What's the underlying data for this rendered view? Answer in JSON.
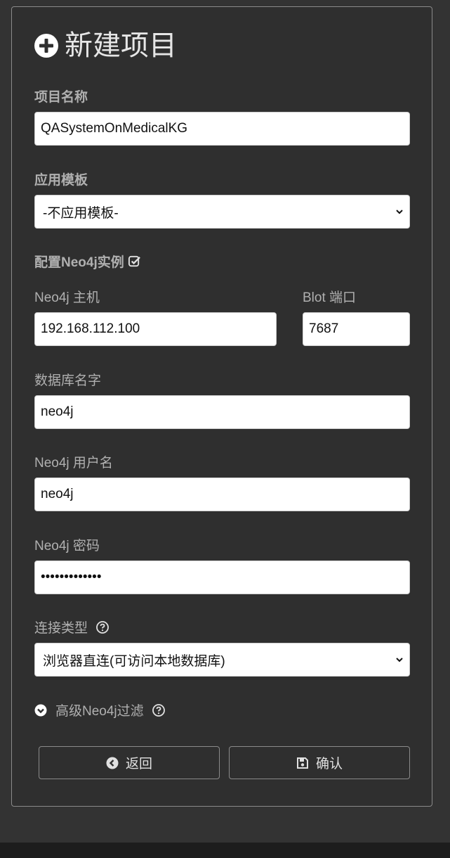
{
  "header": {
    "title": "新建项目",
    "icon": "plus-circle-icon"
  },
  "form": {
    "project_name": {
      "label": "项目名称",
      "value": "QASystemOnMedicalKG"
    },
    "template": {
      "label": "应用模板",
      "selected": "-不应用模板-"
    },
    "neo4j_config": {
      "label": "配置Neo4j实例",
      "icon": "checkbox-checked-icon"
    },
    "host": {
      "label": "Neo4j 主机",
      "value": "192.168.112.100"
    },
    "port": {
      "label": "Blot 端口",
      "value": "7687"
    },
    "database": {
      "label": "数据库名字",
      "value": "neo4j"
    },
    "username": {
      "label": "Neo4j 用户名",
      "value": "neo4j"
    },
    "password": {
      "label": "Neo4j 密码",
      "value": "•••••••••••••"
    },
    "connection_type": {
      "label": "连接类型",
      "selected": "浏览器直连(可访问本地数据库)",
      "help_icon": "question-circle-icon"
    },
    "advanced_filter": {
      "label": "高级Neo4j过滤",
      "icon": "chevron-circle-down-icon",
      "help_icon": "question-circle-icon"
    }
  },
  "actions": {
    "back": {
      "label": "返回",
      "icon": "arrow-circle-left-icon"
    },
    "confirm": {
      "label": "确认",
      "icon": "save-icon"
    }
  },
  "colors": {
    "background": "#333333",
    "panel": "#2f2f2f",
    "label": "#b0b0b0",
    "title": "#e6e6e6"
  }
}
